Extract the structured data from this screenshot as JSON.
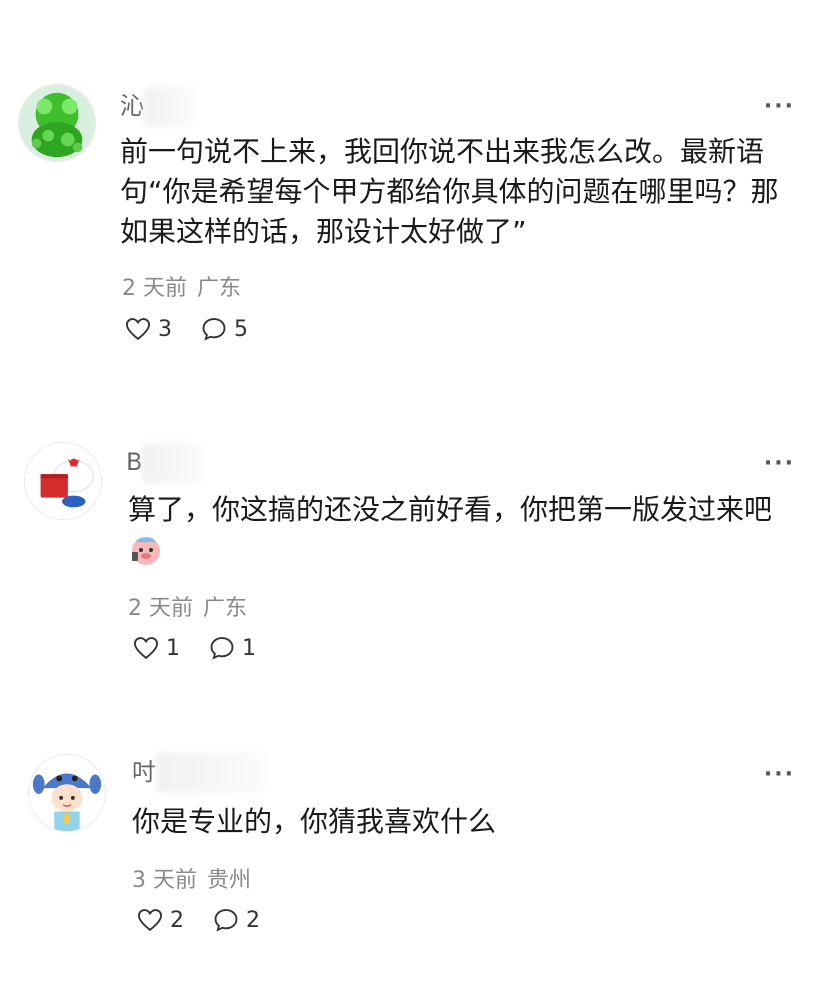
{
  "comments": [
    {
      "username_visible": "沁",
      "text": "前一句说不上来，我回你说不出来我怎么改。最新语句“你是希望每个甲方都给你具体的问题在哪里吗？那如果这样的话，那设计太好做了”",
      "time": "2 天前",
      "location": "广东",
      "likes": "3",
      "replies": "5",
      "more": "···"
    },
    {
      "username_visible": "B",
      "text": "算了，你这搞的还没之前好看，你把第一版发过来吧",
      "time": "2 天前",
      "location": "广东",
      "likes": "1",
      "replies": "1",
      "more": "···"
    },
    {
      "username_visible": "吋",
      "text": "你是专业的，你猜我喜欢什么",
      "time": "3 天前",
      "location": "贵州",
      "likes": "2",
      "replies": "2",
      "more": "···"
    }
  ],
  "icons": [
    "heart-icon",
    "comment-bubble-icon",
    "more-options-icon",
    "sticker-emoji-icon"
  ],
  "colors": {
    "text": "#1a1a1a",
    "meta": "#8a8a8a",
    "username": "#666666",
    "background": "#ffffff"
  }
}
